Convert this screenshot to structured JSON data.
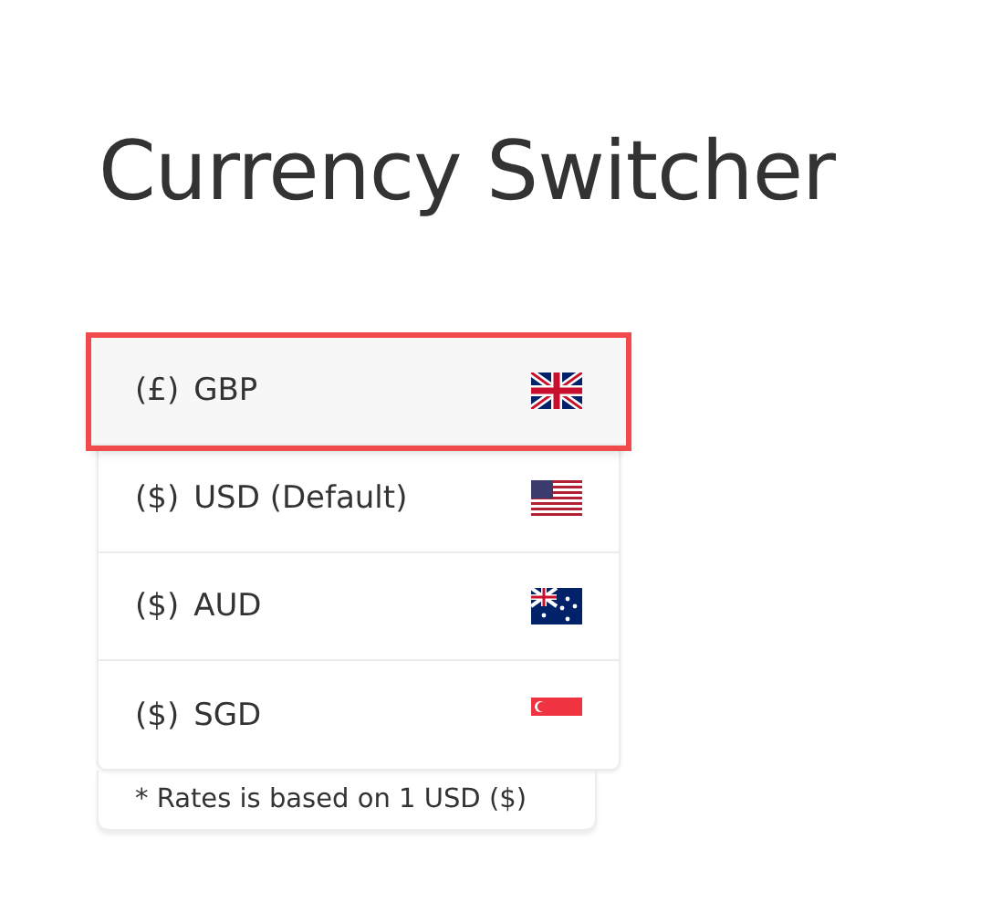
{
  "title": "Currency Switcher",
  "currencies": [
    {
      "symbol": "(£)",
      "code": "GBP",
      "kind": "gb",
      "selected": true
    },
    {
      "symbol": "($)",
      "code": "USD (Default)",
      "kind": "us",
      "selected": false
    },
    {
      "symbol": "($)",
      "code": "AUD",
      "kind": "au",
      "selected": false
    },
    {
      "symbol": "($)",
      "code": "SGD",
      "kind": "sg",
      "selected": false
    }
  ],
  "note": "* Rates is based on 1 USD ($)"
}
